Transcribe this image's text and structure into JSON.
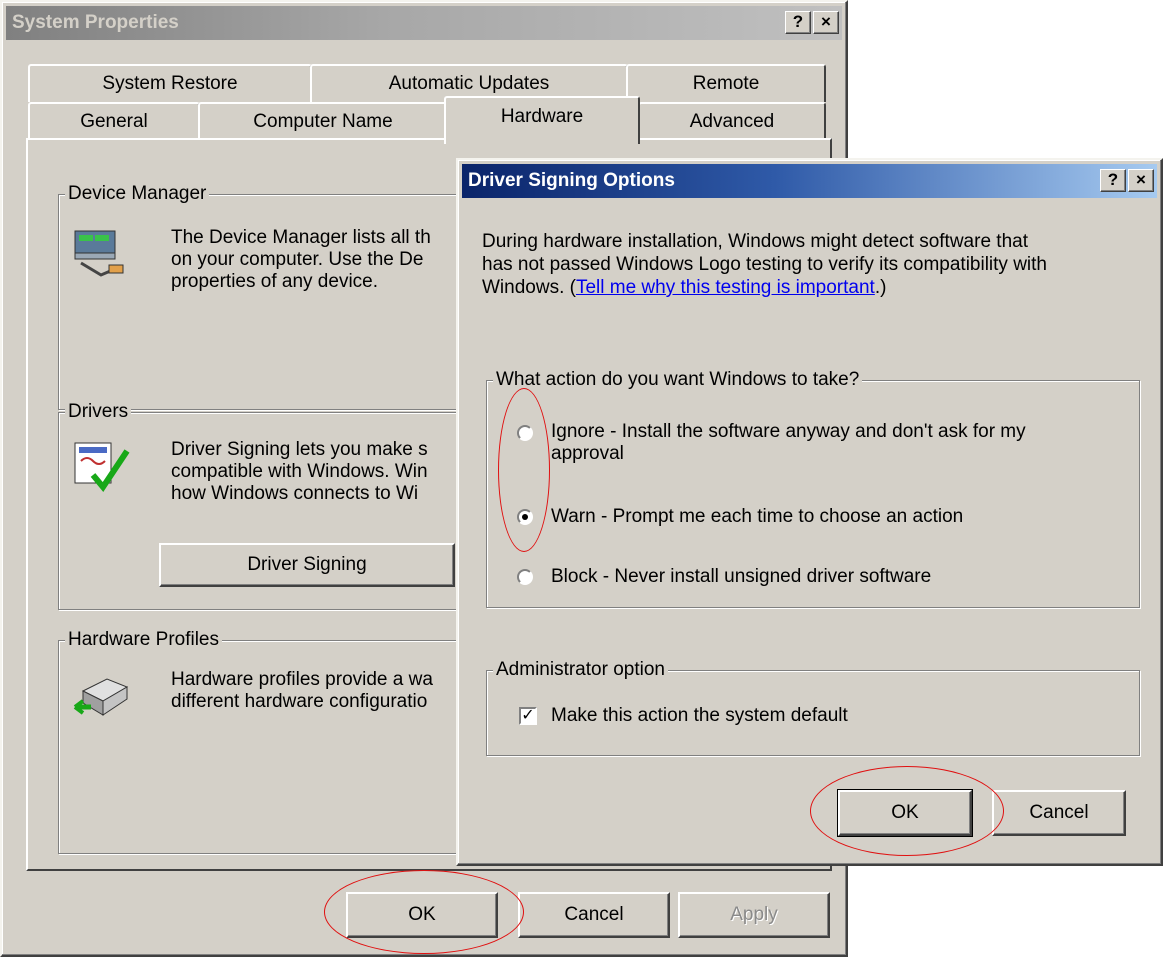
{
  "system_properties": {
    "title": "System Properties",
    "help_button": "?",
    "close_button": "×",
    "tabs_back": [
      "System Restore",
      "Automatic Updates",
      "Remote"
    ],
    "tabs_front": [
      "General",
      "Computer Name",
      "Hardware",
      "Advanced"
    ],
    "selected_tab": "Hardware",
    "device_manager": {
      "legend": "Device Manager",
      "lines": [
        "The Device Manager lists all th",
        "on your computer. Use the De",
        "properties of any device."
      ]
    },
    "drivers": {
      "legend": "Drivers",
      "lines": [
        "Driver Signing lets you make s",
        "compatible with Windows. Win",
        "how Windows connects to Wi"
      ],
      "button": "Driver Signing"
    },
    "hardware_profiles": {
      "legend": "Hardware Profiles",
      "lines": [
        "Hardware profiles provide a wa",
        "different hardware configuratio"
      ]
    },
    "buttons": {
      "ok": "OK",
      "cancel": "Cancel",
      "apply": "Apply"
    }
  },
  "driver_signing": {
    "title": "Driver Signing Options",
    "help_button": "?",
    "close_button": "×",
    "desc_line1": "During hardware installation, Windows might detect software that",
    "desc_line2": "has not passed Windows Logo testing to verify its compatibility with",
    "desc_line3_prefix": "Windows. (",
    "desc_link": "Tell me why this testing is important",
    "desc_line3_suffix": ".)",
    "action_group": {
      "legend": "What action do you want Windows to take?",
      "options": [
        {
          "line1": "Ignore - Install the software anyway and don't ask for my",
          "line2": "approval",
          "checked": false
        },
        {
          "line1": "Warn - Prompt me each time to choose an action",
          "checked": true
        },
        {
          "line1": "Block - Never install unsigned driver software",
          "checked": false
        }
      ]
    },
    "admin_group": {
      "legend": "Administrator option",
      "checkbox_label": "Make this action the system default",
      "checkbox_checked": true,
      "check_mark": "✓"
    },
    "buttons": {
      "ok": "OK",
      "cancel": "Cancel"
    }
  },
  "colors": {
    "annotation": "#e01010",
    "active_title": "#0a246a",
    "dialog_face": "#d4d0c8"
  }
}
